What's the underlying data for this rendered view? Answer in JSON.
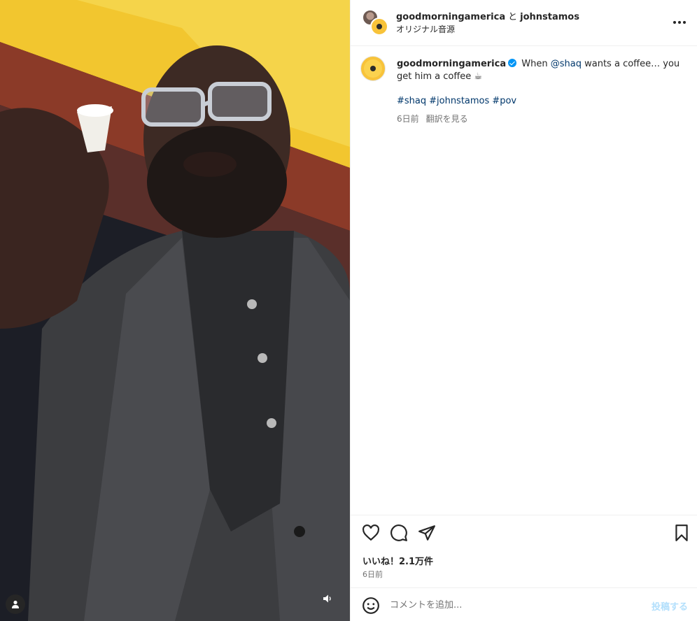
{
  "post": {
    "header": {
      "author": "goodmorningamerica",
      "connector": "と",
      "collaborator": "johnstamos",
      "audio": "オリジナル音源"
    },
    "caption": {
      "username": "goodmorningamerica",
      "text_before_mention": "When",
      "mention": "@shaq",
      "text_after_mention": "wants a coffee… you get him a coffee",
      "emoji": "☕",
      "hashtags": [
        "#shaq",
        "#johnstamos",
        "#pov"
      ],
      "age": "6日前",
      "translate": "翻訳を見る"
    },
    "engagement": {
      "likes": "いいね！2.1万件",
      "date": "6日前"
    },
    "comment": {
      "placeholder": "コメントを追加...",
      "post_label": "投稿する"
    }
  },
  "icons": {
    "like": "heart-icon",
    "comment": "comment-icon",
    "share": "paper-plane-icon",
    "save": "bookmark-icon",
    "more": "more-dots-icon",
    "emoji": "smiley-icon",
    "mute": "speaker-icon",
    "tags": "user-icon"
  },
  "colors": {
    "link": "#00376b",
    "verified": "#0095f6",
    "post_disabled": "#b2dffc",
    "brand_yellow": "#f8c33a"
  }
}
